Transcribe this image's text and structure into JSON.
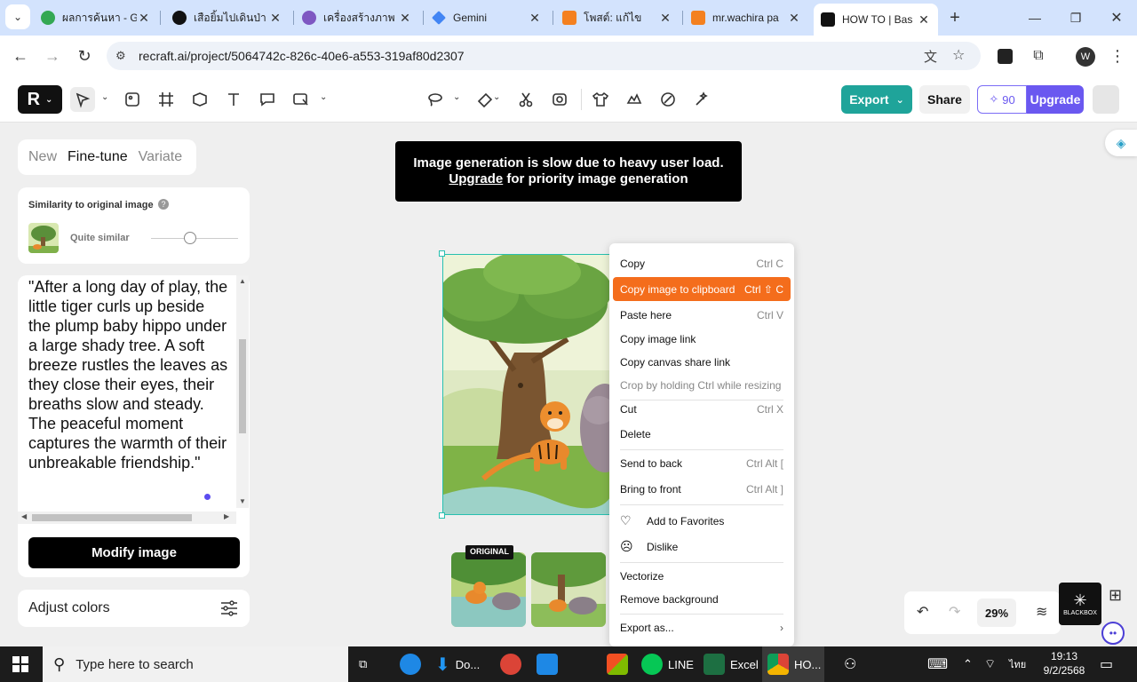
{
  "browser": {
    "tabs": [
      {
        "title": "ผลการค้นหา - G",
        "color": "#34a853"
      },
      {
        "title": "เสือยิ้มไปเดินป่า",
        "color": "#111111"
      },
      {
        "title": "เครื่องสร้างภาพ",
        "color": "#7e57c2"
      },
      {
        "title": "Gemini",
        "color": "#4285f4"
      },
      {
        "title": "โพสต์: แก้ไข",
        "color": "#f4801f"
      },
      {
        "title": "mr.wachira pa",
        "color": "#f4801f"
      },
      {
        "title": "HOW TO | Bas",
        "color": "#111111"
      }
    ],
    "url": "recraft.ai/project/5064742c-826c-40e6-a553-319af80d2307",
    "profile_initial": "W"
  },
  "appbar": {
    "export_label": "Export",
    "share_label": "Share",
    "credits": "90",
    "upgrade_label": "Upgrade"
  },
  "left_panel": {
    "tabs": [
      "New",
      "Fine-tune",
      "Variate"
    ],
    "selected_tab": "Fine-tune",
    "similarity_label": "Similarity to original image",
    "similarity_value_label": "Quite similar",
    "prompt": "\"After a long day of play, the little tiger curls up beside the plump baby hippo under a large shady tree. A soft breeze rustles the leaves as they close their eyes, their breaths slow and steady. The peaceful moment captures the warmth of their unbreakable friendship.\"",
    "modify_button": "Modify image",
    "adjust_colors": "Adjust colors"
  },
  "banner": {
    "line1": "Image generation is slow due to heavy user load.",
    "upgrade_link": "Upgrade",
    "line2_rest": " for priority image generation"
  },
  "thumbnails": {
    "original_badge": "ORIGINAL"
  },
  "context_menu": {
    "items": [
      {
        "label": "Copy",
        "shortcut": "Ctrl C"
      },
      {
        "label": "Copy image to clipboard",
        "shortcut": "Ctrl ⇧ C"
      },
      {
        "label": "Paste here",
        "shortcut": "Ctrl V"
      },
      {
        "label": "Copy image link",
        "shortcut": ""
      },
      {
        "label": "Copy canvas share link",
        "shortcut": ""
      },
      {
        "label": "Crop by holding Ctrl while resizing",
        "shortcut": ""
      },
      {
        "label": "Cut",
        "shortcut": "Ctrl X"
      },
      {
        "label": "Delete",
        "shortcut": ""
      },
      {
        "label": "Send to back",
        "shortcut": "Ctrl Alt ["
      },
      {
        "label": "Bring to front",
        "shortcut": "Ctrl Alt ]"
      },
      {
        "label": "Add to Favorites",
        "shortcut": ""
      },
      {
        "label": "Dislike",
        "shortcut": ""
      },
      {
        "label": "Vectorize",
        "shortcut": ""
      },
      {
        "label": "Remove background",
        "shortcut": ""
      },
      {
        "label": "Export as...",
        "shortcut": ""
      }
    ],
    "highlighted": "Copy image to clipboard"
  },
  "zoom": "29%",
  "blackbox_label": "BLACKBOX",
  "taskbar": {
    "search_placeholder": "Type here to search",
    "apps": [
      {
        "label": "Do...",
        "color": "#1e88e5"
      },
      {
        "label": "LINE",
        "color": "#06c755"
      },
      {
        "label": "Excel",
        "color": "#1d6f42"
      },
      {
        "label": "HO...",
        "color": "#db4437"
      }
    ],
    "lang": "ไทย",
    "time": "19:13",
    "date": "9/2/2568"
  },
  "colors": {
    "tabstrip": "#d3e3fd",
    "accent_teal": "#1fa49a",
    "accent_purple": "#6a58f0",
    "menu_highlight": "#f46d1c"
  }
}
